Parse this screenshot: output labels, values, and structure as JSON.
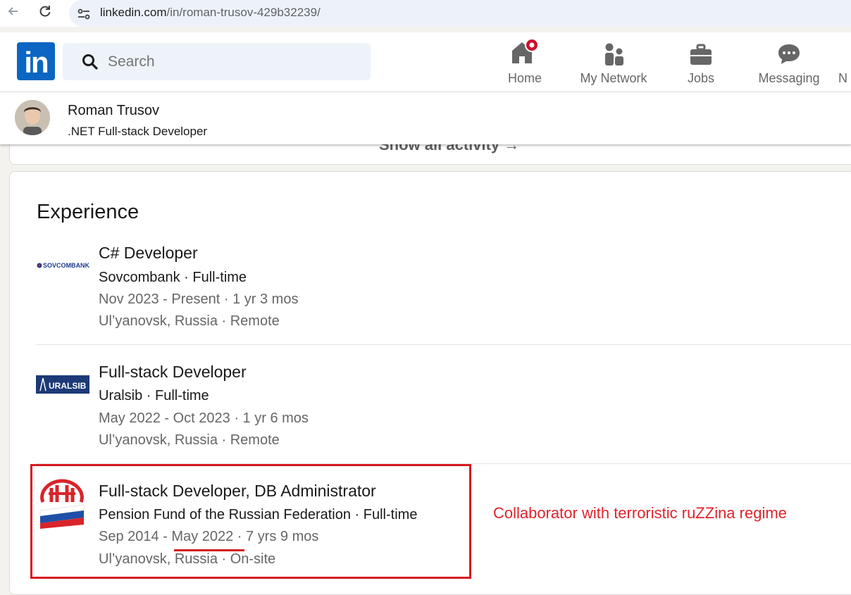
{
  "browser": {
    "url_host": "linkedin.com",
    "url_path": "/in/roman-trusov-429b32239/"
  },
  "header": {
    "logo_text": "in",
    "search_placeholder": "Search",
    "nav": [
      {
        "label": "Home",
        "icon": "home-icon"
      },
      {
        "label": "My Network",
        "icon": "network-icon"
      },
      {
        "label": "Jobs",
        "icon": "briefcase-icon"
      },
      {
        "label": "Messaging",
        "icon": "message-icon"
      },
      {
        "label": "N",
        "icon": "notifications-icon"
      }
    ]
  },
  "sticky_profile": {
    "name": "Roman Trusov",
    "headline": ".NET Full-stack Developer"
  },
  "activity": {
    "show_all": "Show all activity →"
  },
  "experience": {
    "title": "Experience",
    "entries": [
      {
        "title": "C# Developer",
        "company": "Sovcombank · Full-time",
        "dates": "Nov 2023 - Present · 1 yr 3 mos",
        "location": "Ul’yanovsk, Russia · Remote",
        "logo": "SOVCOMBANK"
      },
      {
        "title": "Full-stack Developer",
        "company": "Uralsib · Full-time",
        "dates": "May 2022 - Oct 2023 · 1 yr 6 mos",
        "location": "Ul’yanovsk, Russia · Remote",
        "logo": "URALSIB"
      },
      {
        "title": "Full-stack Developer, DB Administrator",
        "company": "Pension Fund of the Russian Federation · Full-time",
        "dates": "Sep 2014 - May 2022 · 7 yrs 9 mos",
        "location": "Ul’yanovsk, Russia · On-site",
        "logo": "pension-fund-logo"
      }
    ]
  },
  "annotation": {
    "text": "Collaborator with terroristic ruZZina regime",
    "color": "#e0242b"
  },
  "colors": {
    "linkedin_blue": "#0a66c2",
    "annotation_red": "#d71920"
  }
}
